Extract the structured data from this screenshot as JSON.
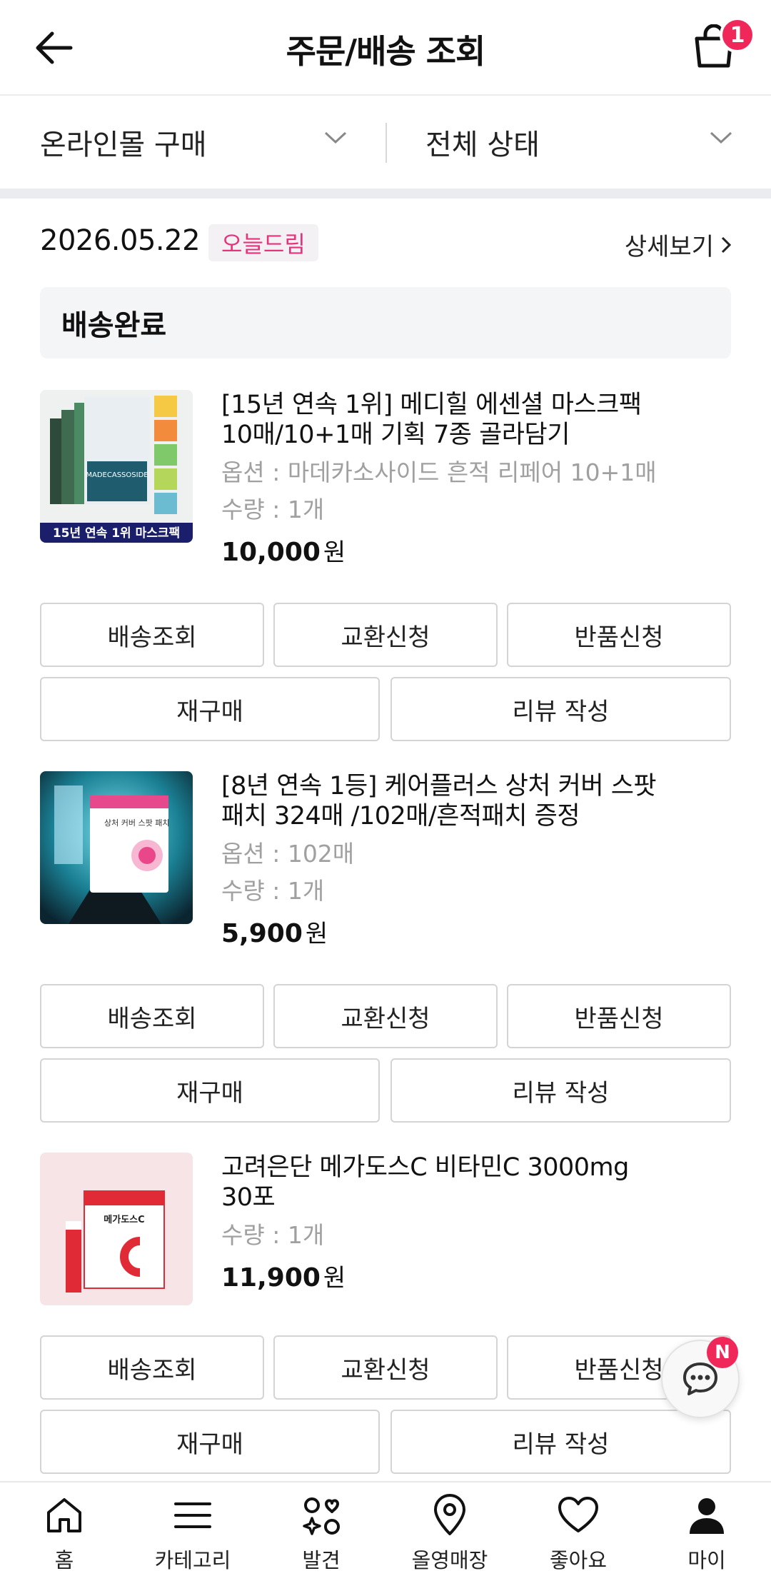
{
  "header": {
    "title": "주문/배송 조회",
    "cart_count": "1"
  },
  "filters": {
    "channel": "온라인몰 구매",
    "status": "전체 상태"
  },
  "order": {
    "date": "2026.05.22",
    "tag": "오늘드림",
    "detail_link": "상세보기",
    "status": "배송완료",
    "items": [
      {
        "name_line1": "[15년 연속 1위] 메디힐 에센셜 마스크팩",
        "name_line2": "10매/10+1매 기획 7종 골라담기",
        "option": "옵션 : 마데카소사이드 흔적 리페어 10+1매",
        "quantity": "수량 : 1개",
        "price": "10,000",
        "currency": "원",
        "thumb_caption": "15년 연속 1위 마스크팩",
        "thumb_brand": "MADECASSOSIDE"
      },
      {
        "name_line1": "[8년 연속 1등] 케어플러스 상처 커버 스팟",
        "name_line2": "패치 324매 /102매/흔적패치 증정",
        "option": "옵션 : 102매",
        "quantity": "수량 : 1개",
        "price": "5,900",
        "currency": "원",
        "thumb_label": "상처 커버 스팟 패치"
      },
      {
        "name_line1": "고려은단 메가도스C 비타민C 3000mg",
        "name_line2": "30포",
        "quantity": "수량 : 1개",
        "price": "11,900",
        "currency": "원",
        "thumb_label": "메가도스C"
      }
    ]
  },
  "buttons": {
    "tracking": "배송조회",
    "exchange": "교환신청",
    "return": "반품신청",
    "rebuy": "재구매",
    "review": "리뷰 작성"
  },
  "chat": {
    "badge": "N"
  },
  "bottom_nav": [
    {
      "label": "홈",
      "icon": "home-icon"
    },
    {
      "label": "카테고리",
      "icon": "menu-icon"
    },
    {
      "label": "발견",
      "icon": "discover-icon"
    },
    {
      "label": "올영매장",
      "icon": "location-pin-icon"
    },
    {
      "label": "좋아요",
      "icon": "heart-icon"
    },
    {
      "label": "마이",
      "icon": "person-icon"
    }
  ],
  "colors": {
    "accent": "#f0285a",
    "tag_text": "#e6337b",
    "muted": "#a0a0a0"
  }
}
